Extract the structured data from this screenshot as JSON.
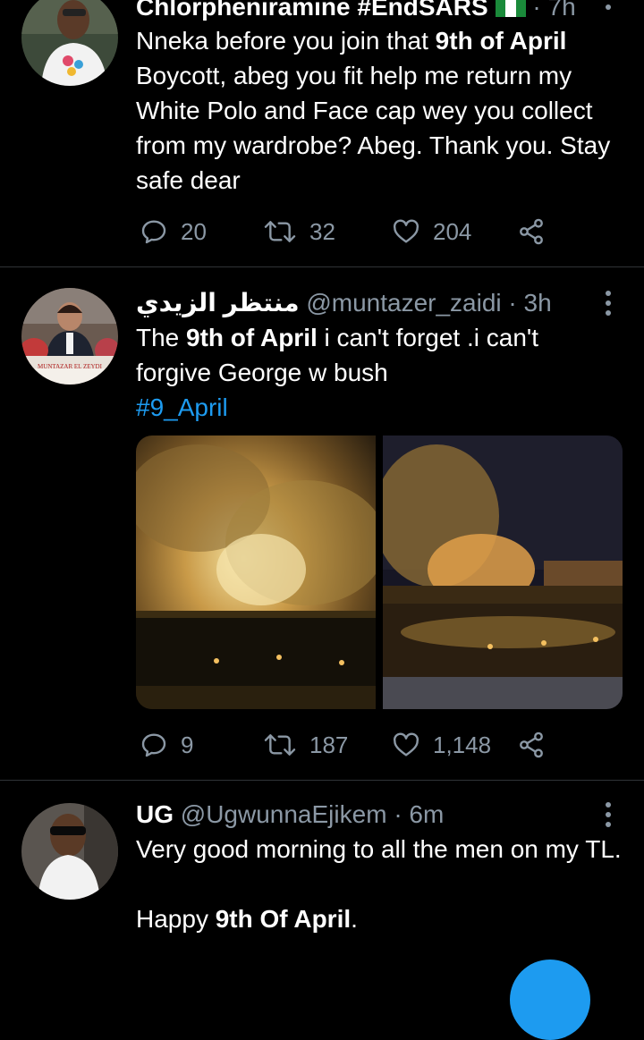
{
  "tweets": [
    {
      "name": "Chlorpheniramine #EndSARS",
      "handle": "",
      "time": "· 7h",
      "body_parts": [
        "Nneka before you join that ",
        "9th of April",
        " Boycott, abeg you fit help me return my White Polo and Face cap wey you collect from my wardrobe? Abeg. Thank you. Stay safe dear"
      ],
      "replies": "20",
      "retweets": "32",
      "likes": "204"
    },
    {
      "name": "منتظر الزيدي",
      "handle": "@muntazer_zaidi",
      "time": "· 3h",
      "body_parts": [
        "The ",
        "9th of April",
        " i can't forget  .i can't forgive George w bush"
      ],
      "hashtag": "#9_April",
      "avatar_caption": "MUNTAZAR EL ZEYDI",
      "replies": "9",
      "retweets": "187",
      "likes": "1,148"
    },
    {
      "name": "UG",
      "handle": "@UgwunnaEjikem",
      "time": "· 6m",
      "body_line1": "Very good morning to all the men on my TL.",
      "body_parts2": [
        "Happy ",
        "9th Of April",
        "."
      ]
    }
  ],
  "colors": {
    "background": "#000000",
    "text": "#ffffff",
    "muted": "#8b98a5",
    "link": "#1d9bf0",
    "divider": "#2f3336"
  },
  "icons": [
    "reply-icon",
    "retweet-icon",
    "like-icon",
    "share-icon",
    "more-icon",
    "nigeria-flag-icon"
  ]
}
